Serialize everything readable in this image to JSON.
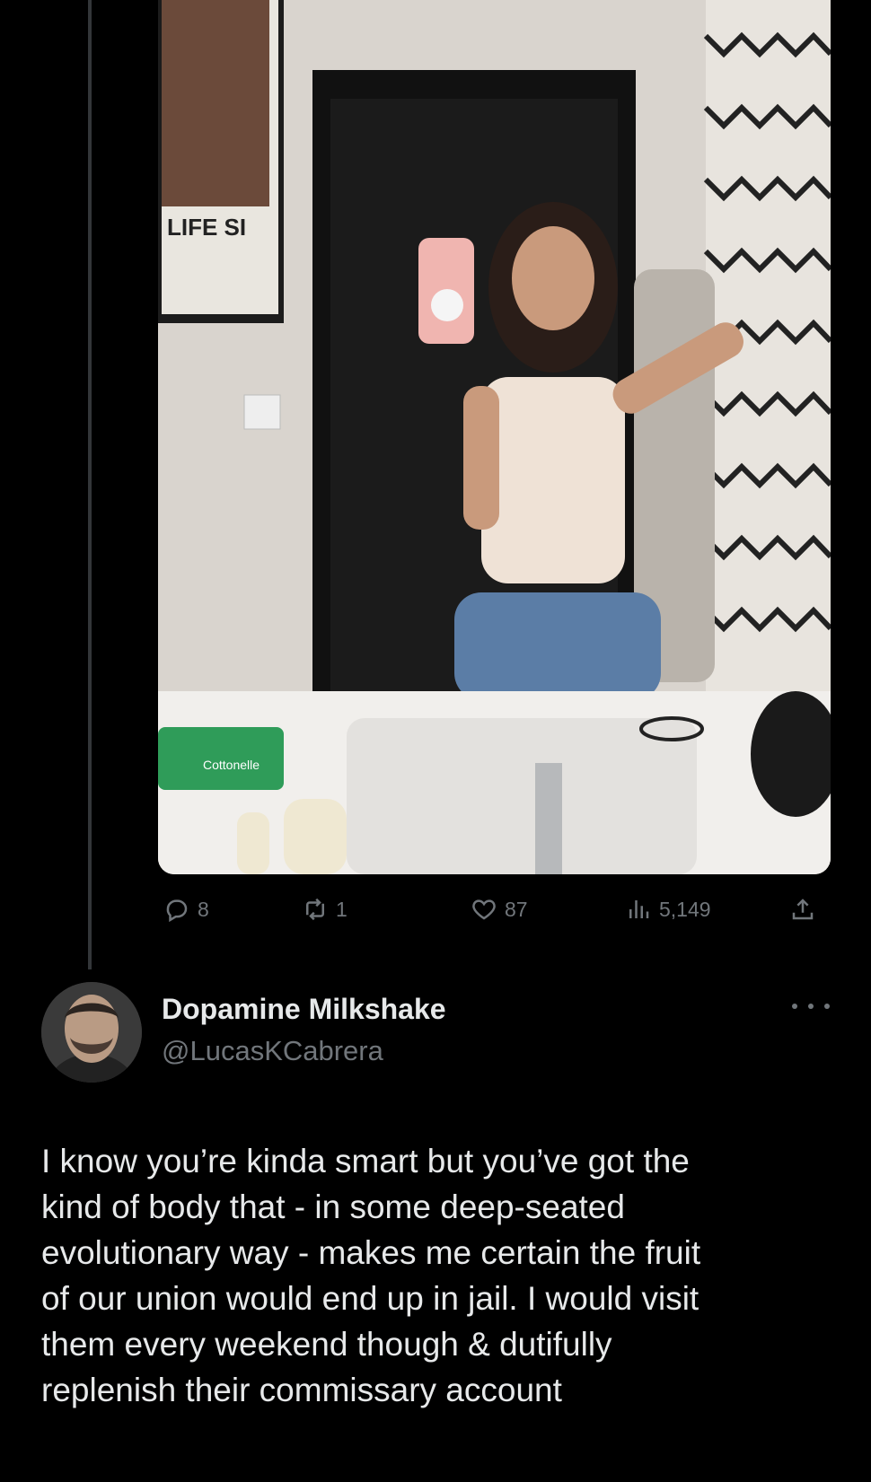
{
  "metrics": {
    "replies": "8",
    "reposts": "1",
    "likes": "87",
    "views": "5,149"
  },
  "icons": {
    "reply": "speech-bubble-icon",
    "repost": "repost-arrows-icon",
    "like": "heart-icon",
    "views": "bar-chart-icon",
    "share": "share-upload-icon",
    "more": "ellipsis-icon"
  },
  "poster_text": "LIFE SI",
  "wipes_brand": "Cottonelle",
  "reply": {
    "display_name": "Dopamine Milkshake",
    "handle": "@LucasKCabrera",
    "text_lines": [
      "I know you’re kinda smart but you’ve got the",
      "kind of body that -  in some deep-seated",
      "evolutionary way - makes me certain the fruit",
      "of our union would end up in jail.  I would visit",
      "them every weekend though & dutifully",
      "replenish their commissary account"
    ]
  },
  "colors": {
    "background": "#000000",
    "text_primary": "#e7e9ea",
    "text_secondary": "#71767b",
    "thread_line": "#333639"
  }
}
